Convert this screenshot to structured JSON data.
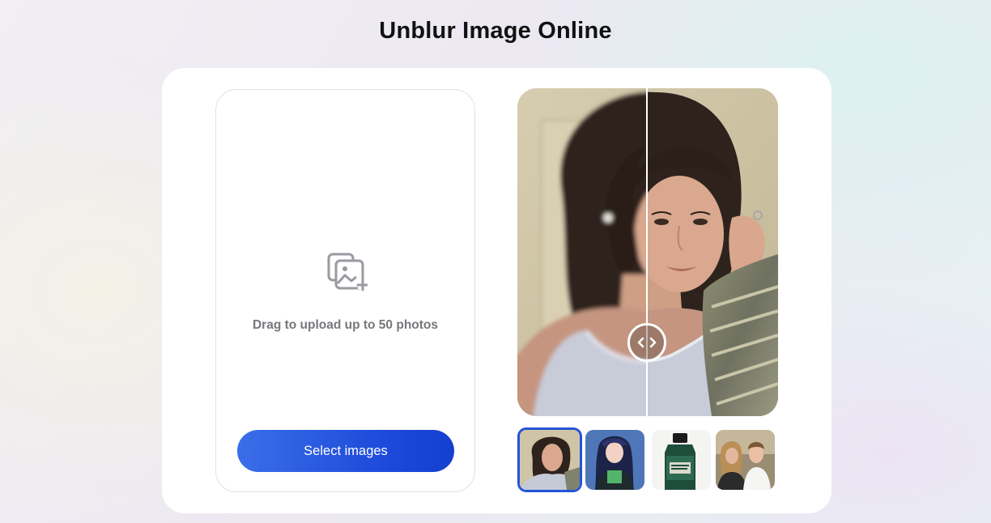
{
  "page": {
    "title": "Unblur Image Online"
  },
  "upload": {
    "icon": "add-image-icon",
    "drag_text": "Drag to upload up to 50 photos",
    "select_button_label": "Select images"
  },
  "comparison": {
    "handle_icon": "chevron-left-right-icon",
    "divider_position": 0.5
  },
  "thumbnails": [
    {
      "name": "woman-portrait",
      "selected": true
    },
    {
      "name": "anime-character",
      "selected": false
    },
    {
      "name": "product-bottle",
      "selected": false
    },
    {
      "name": "two-people-photo",
      "selected": false
    }
  ],
  "colors": {
    "accent": "#2553d8",
    "button_start": "#3b6ee8",
    "button_end": "#1440cf",
    "muted_text": "#77777c"
  }
}
